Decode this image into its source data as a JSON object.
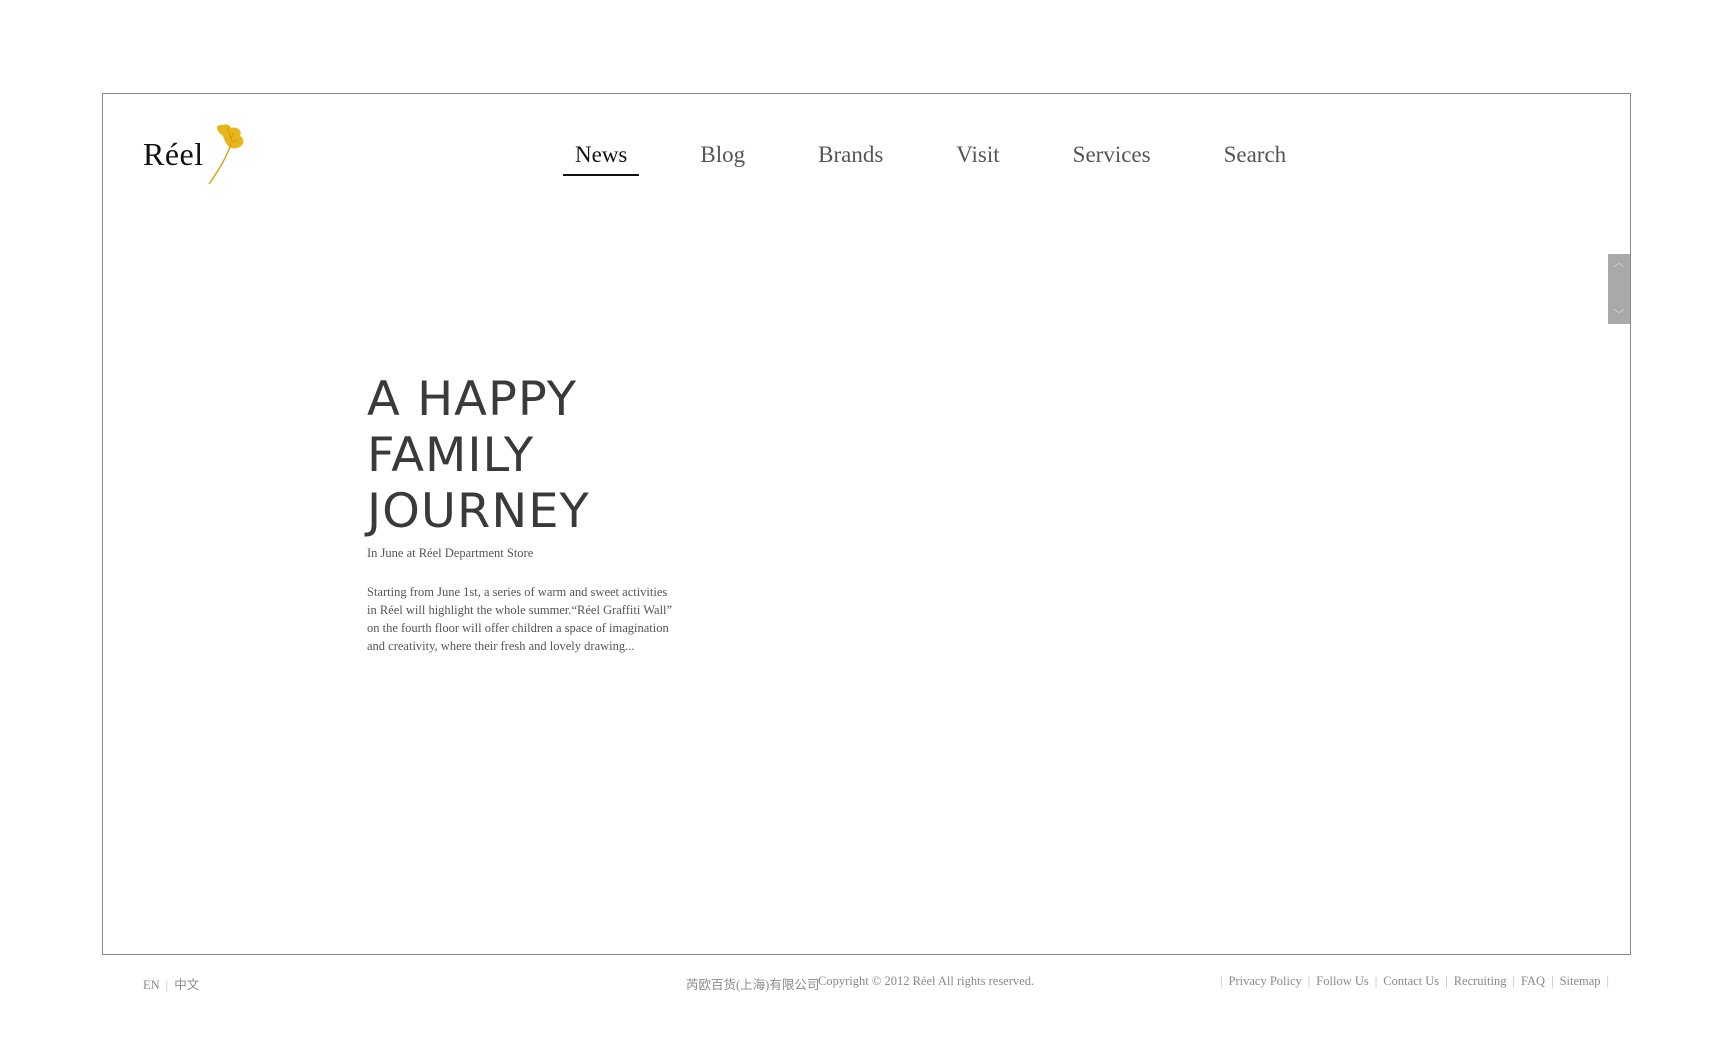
{
  "brand": {
    "logo_text": "Réel",
    "leaf_color": "#E8B51A"
  },
  "nav": {
    "items": [
      {
        "label": "News",
        "active": true
      },
      {
        "label": "Blog",
        "active": false
      },
      {
        "label": "Brands",
        "active": false
      },
      {
        "label": "Visit",
        "active": false
      },
      {
        "label": "Services",
        "active": false
      },
      {
        "label": "Search",
        "active": false
      }
    ]
  },
  "article": {
    "headline_lines": [
      "A HAPPY",
      "FAMILY",
      "JOURNEY"
    ],
    "subtitle": "In June at Réel Department Store",
    "body_lines": [
      "Starting from June 1st, a series of warm and sweet activities",
      "in Réel will highlight the whole summer.“Réel Graffiti Wall”",
      "on the fourth floor will offer children a space of imagination",
      "and creativity, where their fresh and lovely drawing..."
    ]
  },
  "scroll_control": {
    "up_icon": "chevron-up-icon",
    "down_icon": "chevron-down-icon"
  },
  "footer": {
    "languages": [
      "EN",
      "中文"
    ],
    "company": "芮欧百货(上海)有限公司",
    "copyright": "Copyright © 2012 Réel All rights reserved.",
    "links": [
      "Privacy Policy",
      "Follow Us",
      "Contact Us",
      "Recruiting",
      "FAQ",
      "Sitemap"
    ]
  }
}
